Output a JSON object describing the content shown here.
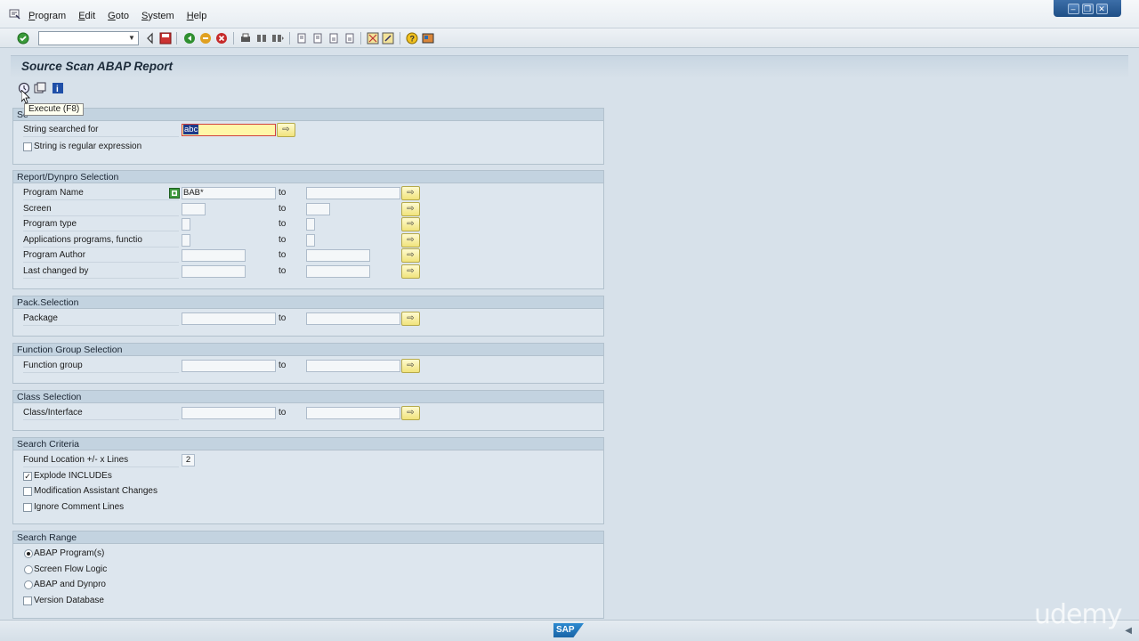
{
  "menubar": {
    "items": [
      "Program",
      "Edit",
      "Goto",
      "System",
      "Help"
    ]
  },
  "window_controls": [
    "minimize-icon",
    "restore-icon",
    "close-icon"
  ],
  "toolbar": {
    "command_field": "",
    "icons": [
      "enter-icon",
      "save-icon",
      "back-icon",
      "exit-icon",
      "cancel-icon",
      "print-icon",
      "find-icon",
      "find-next-icon",
      "first-page-icon",
      "previous-page-icon",
      "next-page-icon",
      "last-page-icon",
      "new-session-icon",
      "shortcut-icon",
      "help-icon",
      "customize-layout-icon"
    ]
  },
  "title": "Source Scan ABAP Report",
  "app_toolbar": {
    "tooltip": "Execute    (F8)"
  },
  "groups": {
    "search_string": {
      "header": "Se",
      "string_label": "String searched for",
      "string_value": "abc",
      "regex_label": "String is regular expression"
    },
    "report_selection": {
      "header": "Report/Dynpro Selection",
      "to": "to",
      "rows": [
        {
          "label": "Program Name",
          "from": "BAB*",
          "to_value": ""
        },
        {
          "label": "Screen",
          "from": "",
          "to_value": ""
        },
        {
          "label": "Program type",
          "from": "",
          "to_value": ""
        },
        {
          "label": "Applications programs, functio",
          "from": "",
          "to_value": ""
        },
        {
          "label": "Program Author",
          "from": "",
          "to_value": ""
        },
        {
          "label": "Last changed by",
          "from": "",
          "to_value": ""
        }
      ]
    },
    "package": {
      "header": "Pack.Selection",
      "label": "Package",
      "to": "to"
    },
    "function_group": {
      "header": "Function Group Selection",
      "label": "Function group",
      "to": "to"
    },
    "class": {
      "header": "Class Selection",
      "label": "Class/Interface",
      "to": "to"
    },
    "criteria": {
      "header": "Search Criteria",
      "lines_label": "Found Location +/- x Lines",
      "lines_value": "2",
      "explode_label": "Explode INCLUDEs",
      "explode_checked": "✓",
      "modification_label": "Modification Assistant Changes",
      "ignore_label": "Ignore Comment Lines"
    },
    "range": {
      "header": "Search Range",
      "options": [
        "ABAP Program(s)",
        "Screen Flow Logic",
        "ABAP and Dynpro"
      ],
      "selected": "ABAP Program(s)",
      "version_label": "Version Database"
    }
  },
  "status": {
    "logo": "SAP",
    "watermark": "udemy"
  }
}
